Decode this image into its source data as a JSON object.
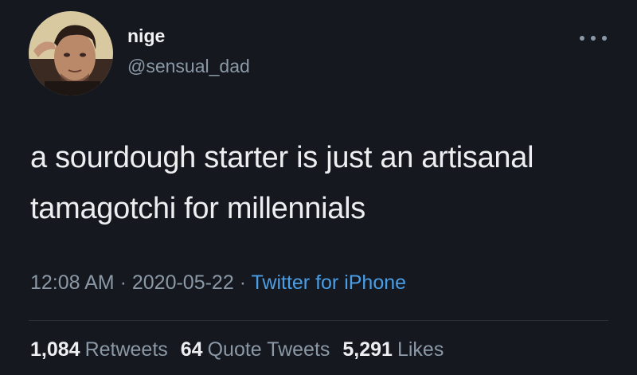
{
  "author": {
    "display_name": "nige",
    "handle": "@sensual_dad",
    "avatar_icon": "profile-photo"
  },
  "more_icon": "ellipsis-icon",
  "tweet": {
    "lines": [
      "a sourdough starter is just an artisanal",
      "tamagotchi for millennials"
    ]
  },
  "meta": {
    "time": "12:08 AM",
    "sep1": " · ",
    "date": "2020-05-22",
    "sep2": " · ",
    "source": "Twitter for iPhone"
  },
  "stats": {
    "retweets_count": "1,084",
    "retweets_label": "Retweets",
    "quotes_count": "64",
    "quotes_label": "Quote Tweets",
    "likes_count": "5,291",
    "likes_label": "Likes"
  },
  "colors": {
    "background": "#15181f",
    "text": "#eceef0",
    "secondary": "#8b98a5",
    "link": "#4a9ee6"
  }
}
